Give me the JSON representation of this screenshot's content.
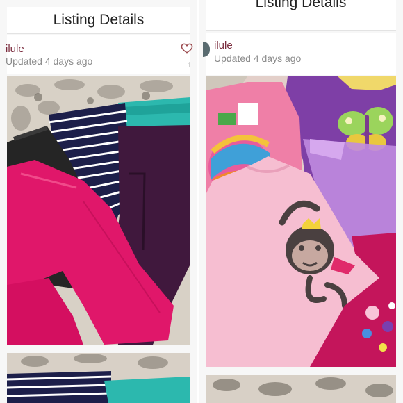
{
  "left_screen": {
    "header": {
      "title": "Listing Details"
    },
    "seller": {
      "name": "ilule",
      "updated": "Updated 4 days ago",
      "like_count": "1"
    },
    "main_photo": {
      "subject": "stack of toddler pants: pink, black, navy striped, teal, purple"
    },
    "next_photo": {
      "subject": "striped and teal pants"
    }
  },
  "right_screen": {
    "header": {
      "title": "Listing Details"
    },
    "seller": {
      "name": "ilule",
      "updated": "Updated 4 days ago"
    },
    "main_photo": {
      "subject": "stack of girls tops: pink monkey tee, Sesame Street tee, purple butterfly tee"
    },
    "next_photo": {
      "subject": "patterned bedding"
    }
  },
  "colors": {
    "seller_name": "#7a2b3d",
    "updated_text": "#8b8b8b",
    "heart": "#9b4a4e"
  },
  "icons": {
    "like": "heart-outline-icon"
  }
}
